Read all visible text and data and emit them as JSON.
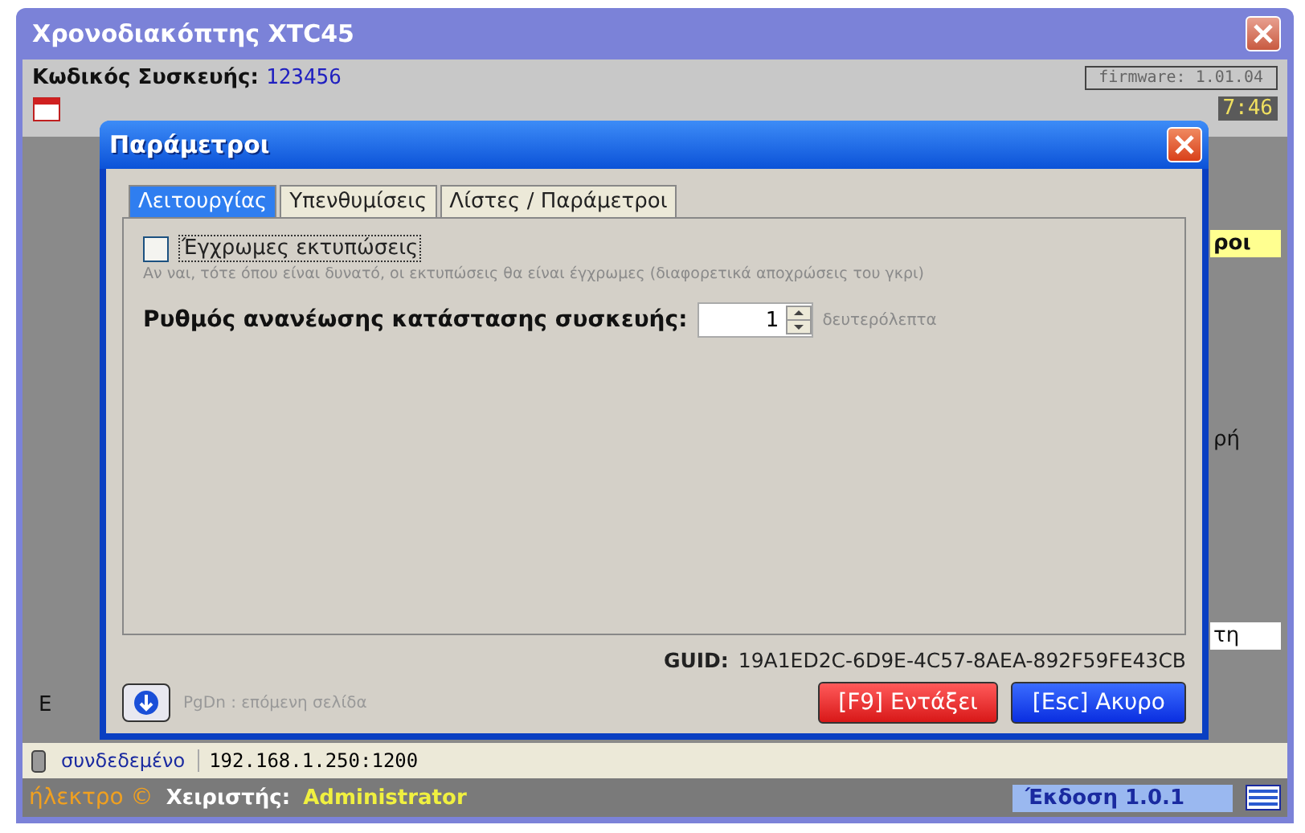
{
  "window": {
    "title": "Χρονοδιακόπτης XTC45",
    "device_code_label": "Κωδικός Συσκευής:",
    "device_code": "123456",
    "firmware": "firmware: 1.01.04",
    "clock_fragment": "7:46",
    "right_fragments": [
      "ροι",
      "ρή",
      "τη"
    ],
    "left_fragment": "Ε"
  },
  "dialog": {
    "title": "Παράμετροι",
    "tabs": [
      {
        "label": "Λειτουργίας",
        "selected": true
      },
      {
        "label": "Υπενθυμίσεις",
        "selected": false
      },
      {
        "label": "Λίστες / Παράμετροι",
        "selected": false
      }
    ],
    "color_print": {
      "label": "Έγχρωμες εκτυπώσεις",
      "checked": false,
      "hint": "Αν ναι, τότε όπου είναι δυνατό, οι εκτυπώσεις θα είναι έγχρωμες (διαφορετικά αποχρώσεις του γκρι)"
    },
    "refresh": {
      "label": "Ρυθμός ανανέωσης κατάστασης συσκευής:",
      "value": "1",
      "unit": "δευτερόλεπτα"
    },
    "guid_label": "GUID:",
    "guid": "19A1ED2C-6D9E-4C57-8AEA-892F59FE43CB",
    "page_hint": "PgDn : επόμενη σελίδα",
    "buttons": [
      {
        "label": "[F9] Εντάξει",
        "kind": "ok"
      },
      {
        "label": "[Esc] Ακυρο",
        "kind": "cancel"
      }
    ]
  },
  "status": {
    "connection": "συνδεδεμένο",
    "address": "192.168.1.250:1200",
    "brand": "ήλεκτρο ©",
    "user_label": "Χειριστής:",
    "user": "Administrator",
    "version": "Έκδοση 1.0.1"
  }
}
